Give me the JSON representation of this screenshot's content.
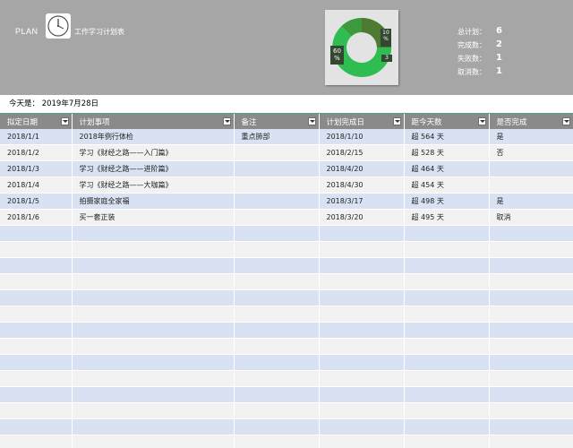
{
  "header": {
    "plan_label": "PLAN",
    "title": "工作学习计划表",
    "icon": "clock-icon",
    "donut": {
      "main_label": "60\n%",
      "small_label": "10\n%",
      "tiny_label": "3"
    },
    "stats": [
      {
        "label": "总计划：",
        "value": "6"
      },
      {
        "label": "完成数：",
        "value": "2"
      },
      {
        "label": "失败数：",
        "value": "1"
      },
      {
        "label": "取消数：",
        "value": "1"
      }
    ]
  },
  "today": {
    "text": "今天是：  2019年7月28日"
  },
  "table": {
    "headers": [
      "拟定日期",
      "计划事项",
      "备注",
      "计划完成日",
      "距今天数",
      "是否完成"
    ],
    "rows": [
      [
        "2018/1/1",
        "2018年例行体检",
        "重点肺部",
        "2018/1/10",
        "超 564 天",
        "是"
      ],
      [
        "2018/1/2",
        "学习《财经之路——入门篇》",
        "",
        "2018/2/15",
        "超 528 天",
        "否"
      ],
      [
        "2018/1/3",
        "学习《财经之路——进阶篇》",
        "",
        "2018/4/20",
        "超 464 天",
        ""
      ],
      [
        "2018/1/4",
        "学习《财经之路——大咖篇》",
        "",
        "2018/4/30",
        "超 454 天",
        ""
      ],
      [
        "2018/1/5",
        "拍摄家庭全家福",
        "",
        "2018/3/17",
        "超 498 天",
        "是"
      ],
      [
        "2018/1/6",
        "买一套正装",
        "",
        "2018/3/20",
        "超 495 天",
        "取消"
      ]
    ],
    "empty_rows": 14
  },
  "colors": {
    "header_bg": "#a6a6a6",
    "donut_green": "#2fbd51",
    "donut_olive": "#4f7a32",
    "row_blue": "#d8e2f3",
    "row_gray": "#f2f2f2"
  }
}
